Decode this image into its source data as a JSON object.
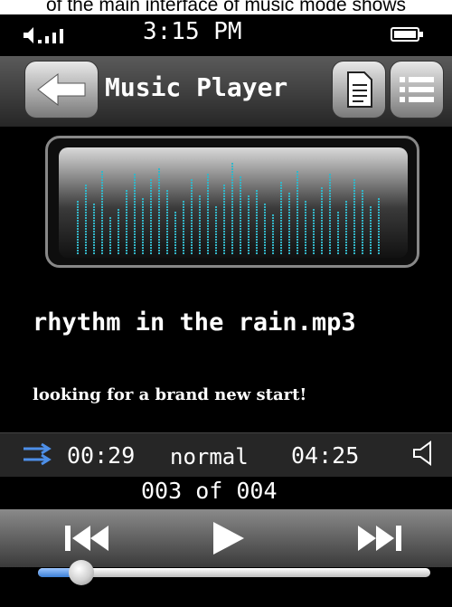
{
  "caption": "of the main interface of music mode shows",
  "status": {
    "time": "3:15 PM"
  },
  "header": {
    "title": "Music Player"
  },
  "track": {
    "song": "rhythm in the rain.mp3",
    "lyric": "looking for a brand new start!"
  },
  "playback": {
    "elapsed": "00:29",
    "mode": "normal",
    "duration": "04:25",
    "position": "003 of 004",
    "progress_fraction": 0.11
  },
  "colors": {
    "accent": "#3b7fd6",
    "visualizer": "#33b6c8"
  },
  "icons": [
    "back-arrow-icon",
    "document-icon",
    "list-icon",
    "signal-icon",
    "battery-icon",
    "shuffle-icon",
    "volume-icon",
    "previous-icon",
    "play-icon",
    "next-icon"
  ]
}
